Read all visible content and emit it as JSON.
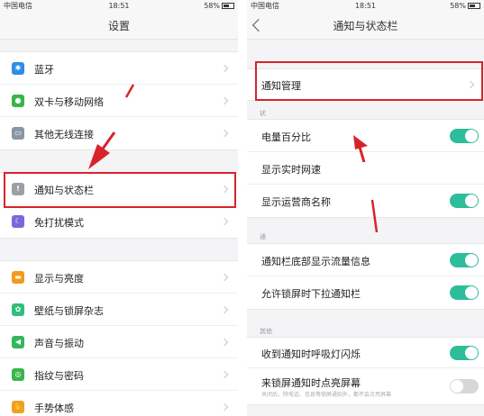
{
  "left": {
    "status": {
      "carrier": "中国电信",
      "time": "18:51",
      "battery": "58%"
    },
    "title": "设置",
    "group1": [
      {
        "label": "蓝牙",
        "icon": "bluetooth-icon",
        "color": "#2f8de4",
        "glyph": "✱"
      },
      {
        "label": "双卡与移动网络",
        "icon": "globe-icon",
        "color": "#3ab54a",
        "glyph": "●"
      },
      {
        "label": "其他无线连接",
        "icon": "wireless-icon",
        "color": "#8a96a3",
        "glyph": "▭"
      }
    ],
    "group2": [
      {
        "label": "通知与状态栏",
        "icon": "notification-icon",
        "color": "#9aa0a6",
        "glyph": "!"
      },
      {
        "label": "免打扰模式",
        "icon": "moon-icon",
        "color": "#7b68d8",
        "glyph": "☾"
      }
    ],
    "group3": [
      {
        "label": "显示与亮度",
        "icon": "display-icon",
        "color": "#f39a1e",
        "glyph": "▬"
      },
      {
        "label": "壁纸与锁屏杂志",
        "icon": "wallpaper-icon",
        "color": "#2fbf7a",
        "glyph": "✿"
      },
      {
        "label": "声音与振动",
        "icon": "sound-icon",
        "color": "#34b65a",
        "glyph": "◀"
      },
      {
        "label": "指纹与密码",
        "icon": "fingerprint-icon",
        "color": "#3bb54a",
        "glyph": "◎"
      },
      {
        "label": "手势体感",
        "icon": "gesture-icon",
        "color": "#f0a020",
        "glyph": "✋"
      }
    ]
  },
  "right": {
    "status": {
      "carrier": "中国电信",
      "time": "18:51",
      "battery": "58%"
    },
    "title": "通知与状态栏",
    "notify_manage": "通知管理",
    "sec1_header": "状",
    "sec1": [
      {
        "label": "电量百分比",
        "on": true
      },
      {
        "label": "显示实时网速",
        "on": null
      },
      {
        "label": "显示运营商名称",
        "on": true
      }
    ],
    "sec2_header": "通",
    "sec2": [
      {
        "label": "通知栏底部显示流量信息",
        "on": true
      },
      {
        "label": "允许锁屏时下拉通知栏",
        "on": true
      }
    ],
    "sec3_header": "其他",
    "sec3": [
      {
        "label": "收到通知时呼吸灯闪烁",
        "on": true
      },
      {
        "label": "来锁屏通知时点亮屏幕",
        "on": false,
        "sub": "关闭后，除电话、信息等锁屏通知外，都不会点亮屏幕"
      }
    ]
  },
  "colors": {
    "annotation_red": "#d8232a",
    "toggle_on": "#2ebd9b"
  }
}
